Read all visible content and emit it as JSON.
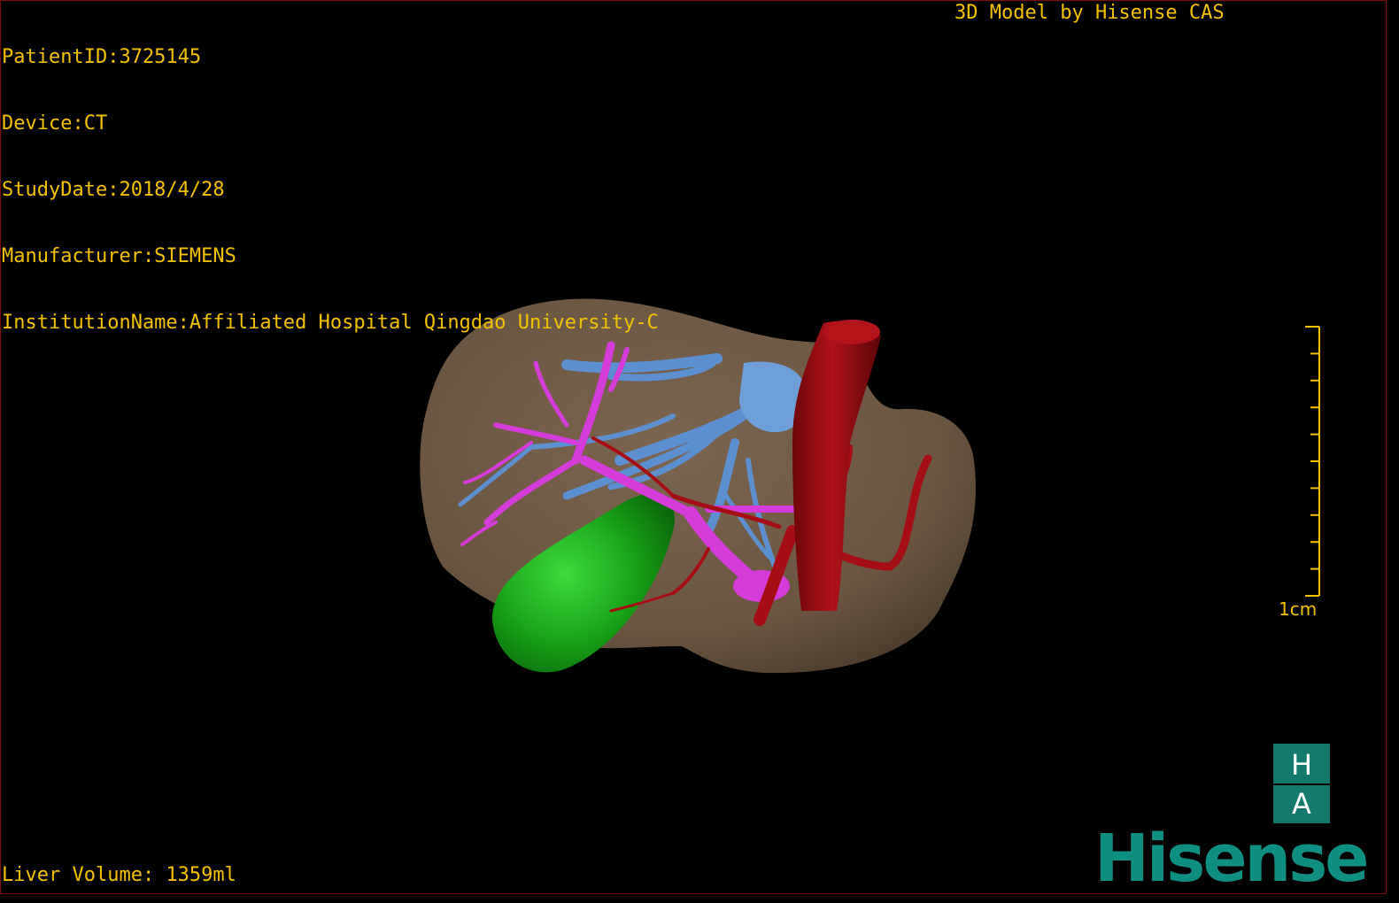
{
  "header": {
    "patient_id": "PatientID:3725145",
    "device": "Device:CT",
    "study_date": "StudyDate:2018/4/28",
    "manufacturer": "Manufacturer:SIEMENS",
    "institution": "InstitutionName:Affiliated Hospital Qingdao University-C"
  },
  "credit": "3D Model by Hisense CAS",
  "footer": {
    "liver_volume": "Liver Volume: 1359ml"
  },
  "scale_bar": {
    "label": "1cm",
    "ticks": 10
  },
  "logo": {
    "top_letter": "H",
    "bottom_letter": "A",
    "brand": "Hisense",
    "color": "#0e8f82"
  },
  "model_colors": {
    "liver": "#6f5a43",
    "gallbladder": "#1aa51a",
    "hepatic_veins": "#5b8fd0",
    "portal_vein": "#d43bd8",
    "ivc_and_arteries": "#a50f14"
  }
}
